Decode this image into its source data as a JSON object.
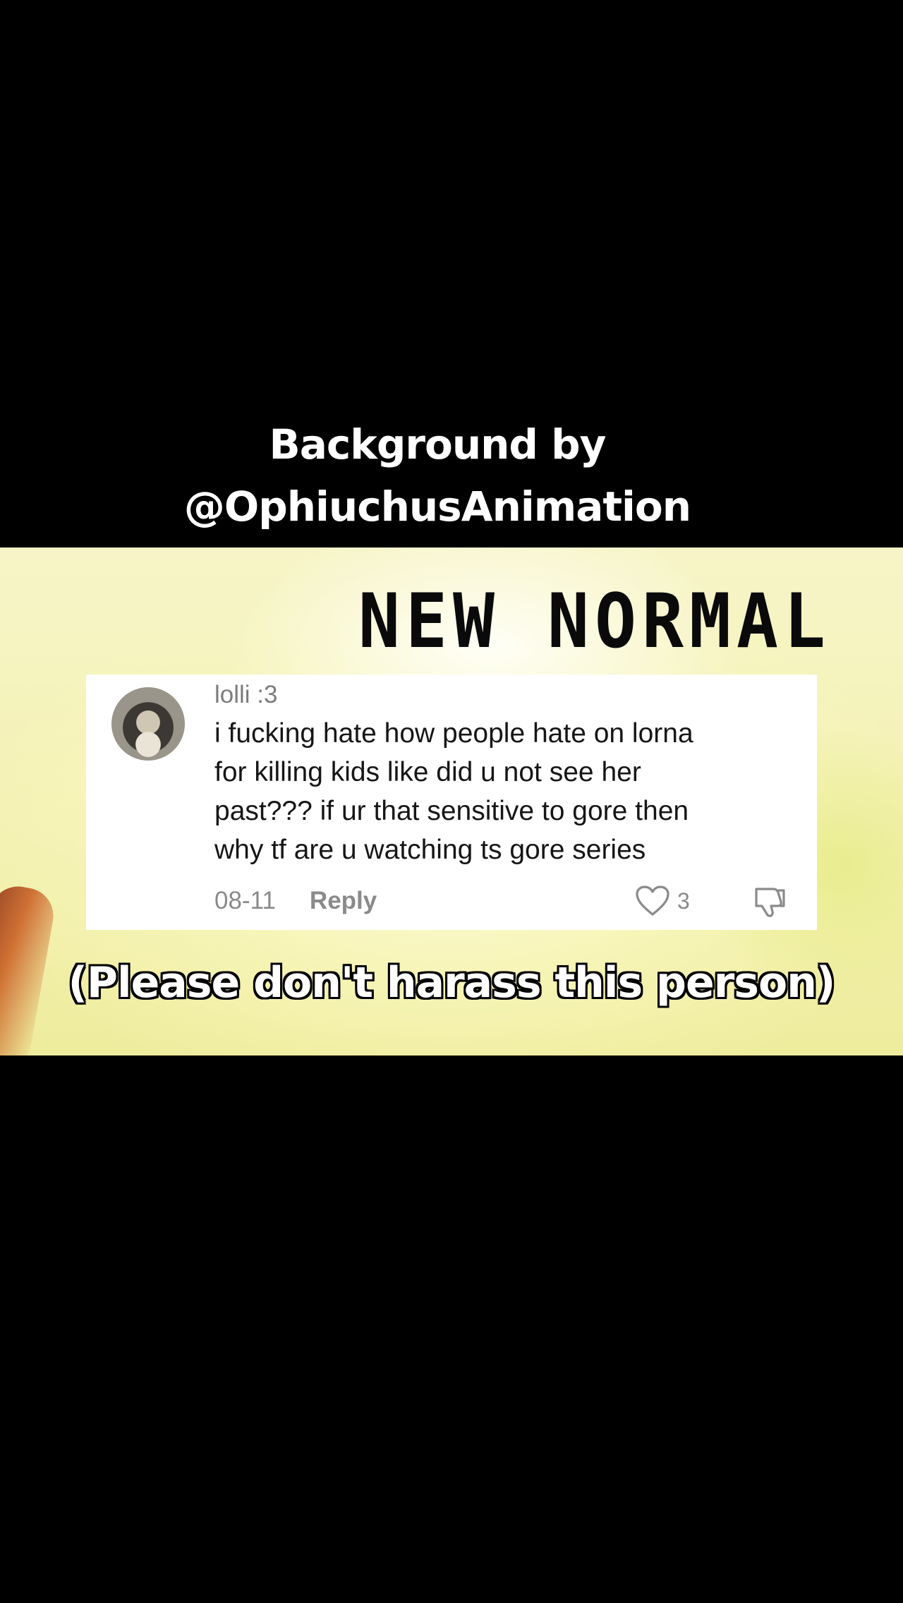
{
  "credit": {
    "line1": "Background by",
    "line2": "@OphiuchusAnimation"
  },
  "headline": "NEW NORMAL",
  "comment": {
    "username": "lolli :3",
    "text_lines": [
      "i fucking hate how people hate on lorna",
      "for killing kids like did u not see her",
      "past??? if ur that sensitive to gore then",
      "why tf are u watching ts gore series"
    ],
    "date": "08-11",
    "reply_label": "Reply",
    "like_count": "3",
    "icons": {
      "like": "heart-icon",
      "dislike": "thumbs-down-icon"
    }
  },
  "notice": "(Please don't harass this person)",
  "colors": {
    "background": "#000000",
    "scene_yellow": "#f7f5c8",
    "card": "#ffffff",
    "muted_text": "#8a8a8a"
  }
}
